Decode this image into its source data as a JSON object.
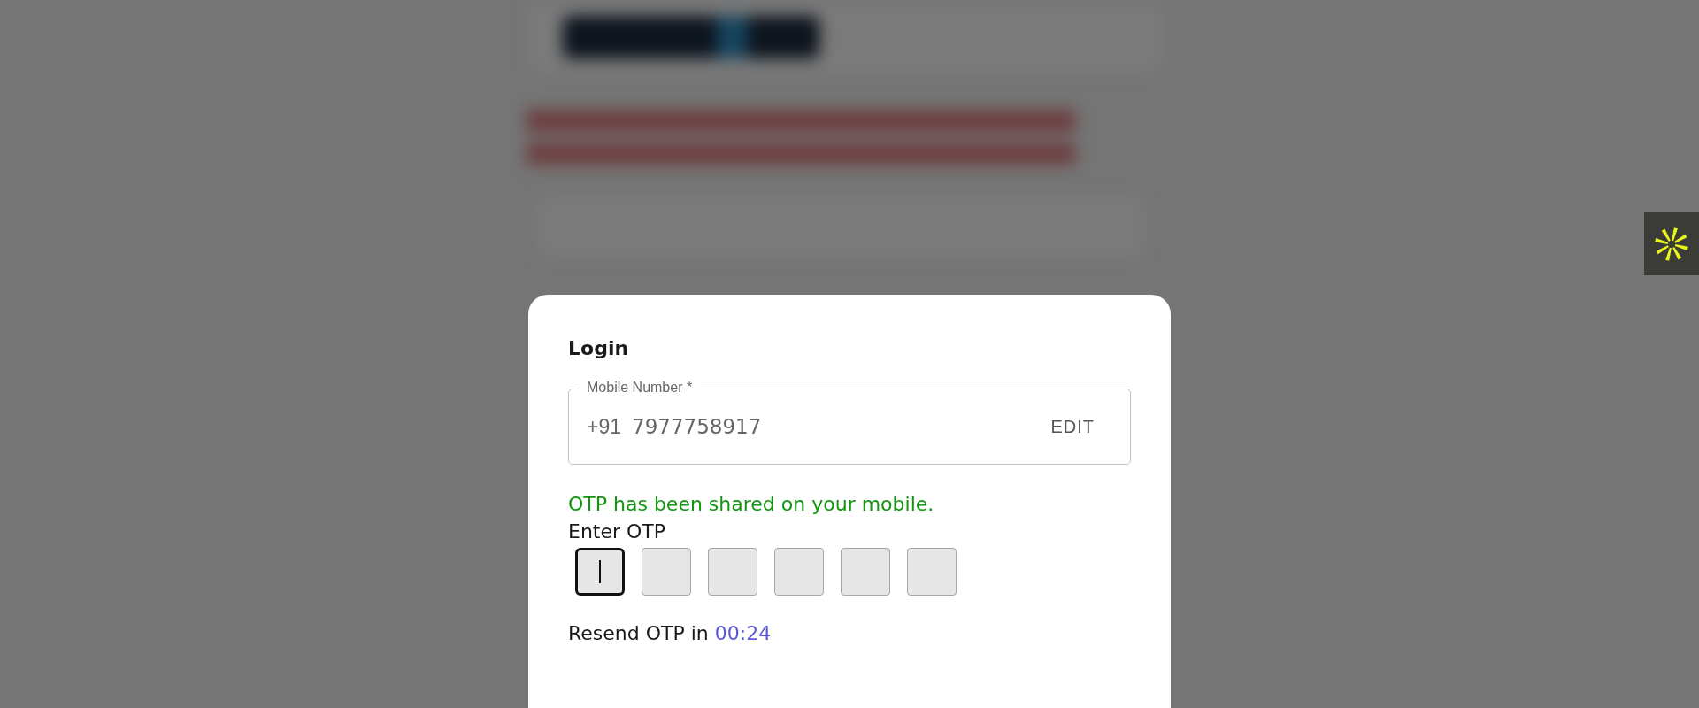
{
  "login_dialog": {
    "title": "Login",
    "mobile_field": {
      "label": "Mobile Number *",
      "prefix": "+91",
      "value": "7977758917",
      "action": "EDIT"
    },
    "status_message": "OTP has been shared on your mobile.",
    "otp_label": "Enter OTP",
    "otp_boxes": [
      {
        "focused": true
      },
      {
        "focused": false
      },
      {
        "focused": false
      },
      {
        "focused": false
      },
      {
        "focused": false
      },
      {
        "focused": false
      }
    ],
    "resend": {
      "text": "Resend OTP in",
      "timer": "00:24"
    }
  }
}
